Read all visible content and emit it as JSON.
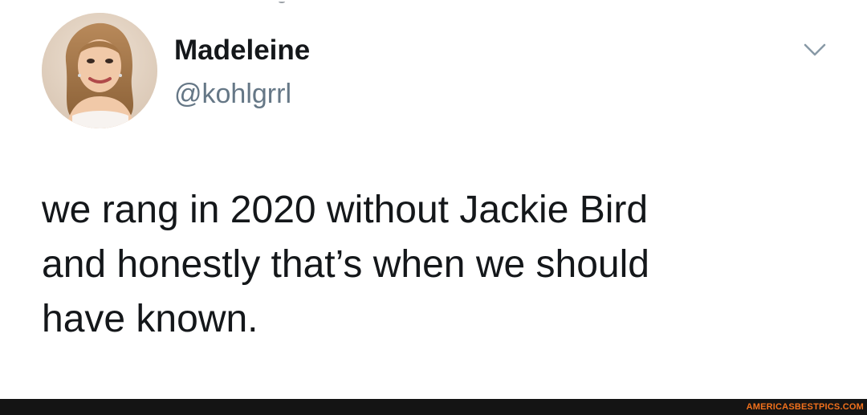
{
  "tweet": {
    "display_name": "Madeleine",
    "handle": "@kohlgrrl",
    "text": "we rang in 2020 without Jackie Bird\nand honestly that’s when we should\nhave known.",
    "menu_icon": "chevron-down-icon"
  },
  "avatar": {
    "icon": "profile-photo"
  },
  "watermark": {
    "text": "AMERICASBESTPICS.COM"
  },
  "colors": {
    "text_primary": "#14171a",
    "text_secondary": "#657786",
    "chevron": "#8899a6",
    "watermark": "#f2711c",
    "bottom_bar": "#141414"
  }
}
